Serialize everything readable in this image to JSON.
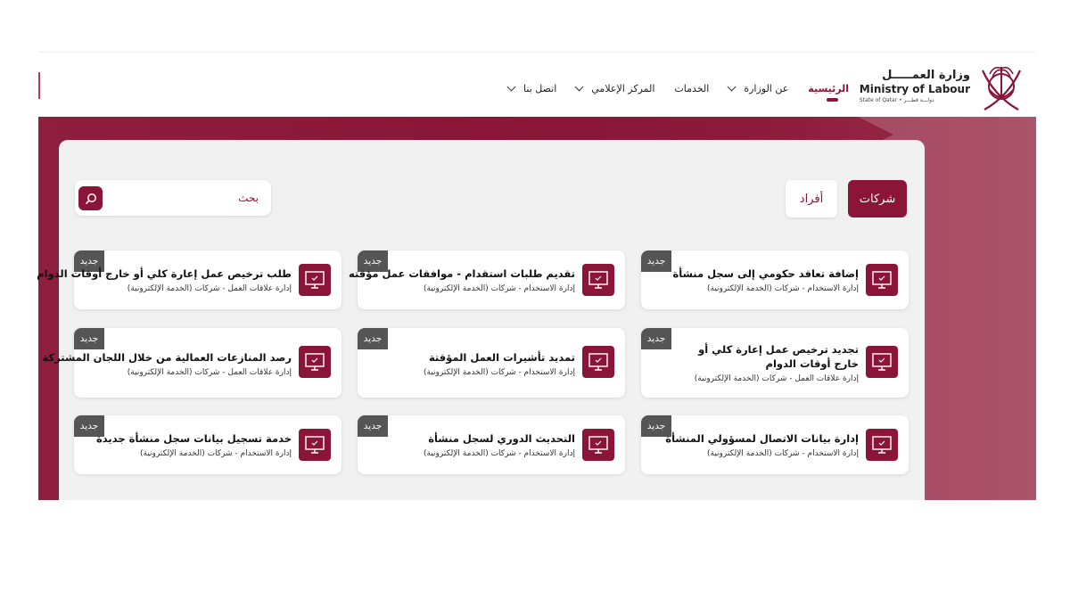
{
  "header": {
    "logo_ar": "وزارة العمـــــل",
    "logo_en": "Ministry of Labour",
    "logo_sub": "State of Qatar • دولـــة قطـــر"
  },
  "nav": {
    "items": [
      {
        "label": "الرئيسية",
        "active": true,
        "dropdown": false
      },
      {
        "label": "عن الوزارة",
        "active": false,
        "dropdown": true
      },
      {
        "label": "الخدمات",
        "active": false,
        "dropdown": false
      },
      {
        "label": "المركز الإعلامي",
        "active": false,
        "dropdown": true
      },
      {
        "label": "اتصل بنا",
        "active": false,
        "dropdown": true
      }
    ]
  },
  "tabs": {
    "companies": "شركات",
    "individuals": "أفراد"
  },
  "search": {
    "placeholder": "بحث",
    "icon": "search-icon"
  },
  "badge_label": "جديد",
  "cards": [
    {
      "title": "إضافة تعاقد حكومي إلى سجل منشأة",
      "subtitle": "إدارة الاستخدام - شركات (الخدمة الإلكترونية)",
      "badge": "جديد",
      "icon": "monitor-check-icon"
    },
    {
      "title": "تقديم طلبات استقدام - موافقات عمل مؤقته",
      "subtitle": "إدارة الاستخدام - شركات (الخدمة الإلكترونية)",
      "badge": "جديد",
      "icon": "monitor-check-icon"
    },
    {
      "title": "طلب ترخيص عمل إعارة كلي أو خارج أوقات الدوام",
      "subtitle": "إدارة علاقات العمل - شركات (الخدمة الإلكترونية)",
      "badge": "جديد",
      "icon": "monitor-check-icon"
    },
    {
      "title": "تجديد ترخيص عمل إعارة كلي أو خارج أوقات الدوام",
      "subtitle": "إدارة علاقات العمل - شركات (الخدمة الإلكترونية)",
      "badge": "جديد",
      "icon": "monitor-check-icon"
    },
    {
      "title": "تمديد تأشيرات العمل المؤقتة",
      "subtitle": "إدارة الاستخدام - شركات (الخدمة الإلكترونية)",
      "badge": "جديد",
      "icon": "monitor-check-icon"
    },
    {
      "title": "رصد المنازعات العمالية من خلال اللجان المشتركة",
      "subtitle": "إدارة علاقات العمل - شركات (الخدمة الإلكترونية)",
      "badge": "جديد",
      "icon": "monitor-check-icon"
    },
    {
      "title": "إدارة بيانات الاتصال لمسؤولي المنشأة",
      "subtitle": "إدارة الاستخدام - شركات (الخدمة الإلكترونية)",
      "badge": "جديد",
      "icon": "monitor-check-icon"
    },
    {
      "title": "التحديث الدوري لسجل منشأة",
      "subtitle": "إدارة الاستخدام - شركات (الخدمة الإلكترونية)",
      "badge": "جديد",
      "icon": "monitor-check-icon"
    },
    {
      "title": "خدمة تسجيل بيانات سجل منشأة جديدة",
      "subtitle": "إدارة الاستخدام - شركات (الخدمة الإلكترونية)",
      "badge": "جديد",
      "icon": "monitor-check-icon"
    }
  ],
  "colors": {
    "brand": "#8a1538",
    "badge": "#555555",
    "panel": "#f1f1f1"
  }
}
